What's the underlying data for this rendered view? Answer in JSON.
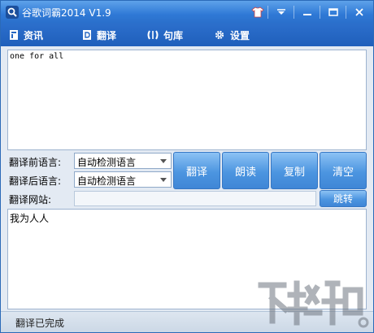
{
  "window": {
    "title": "谷歌词霸2014 V1.9"
  },
  "tabs": [
    {
      "label": "资讯",
      "icon": "document-icon"
    },
    {
      "label": "翻译",
      "icon": "translate-icon"
    },
    {
      "label": "句库",
      "icon": "sentence-library-icon"
    },
    {
      "label": "设置",
      "icon": "gear-icon"
    }
  ],
  "input": {
    "value": "one for all"
  },
  "controls": {
    "source_label": "翻译前语言:",
    "source_value": "自动检测语言",
    "target_label": "翻译后语言:",
    "target_value": "自动检测语言",
    "site_label": "翻译网站:",
    "site_value": "",
    "translate_label": "翻译",
    "read_label": "朗读",
    "copy_label": "复制",
    "clear_label": "清空",
    "jump_label": "跳转"
  },
  "output": {
    "value": "我为人人"
  },
  "status": {
    "text": "翻译已完成"
  },
  "colors": {
    "titlebar": "#3a86dc",
    "tabbar": "#2566c2",
    "button": "#4c95e0"
  }
}
